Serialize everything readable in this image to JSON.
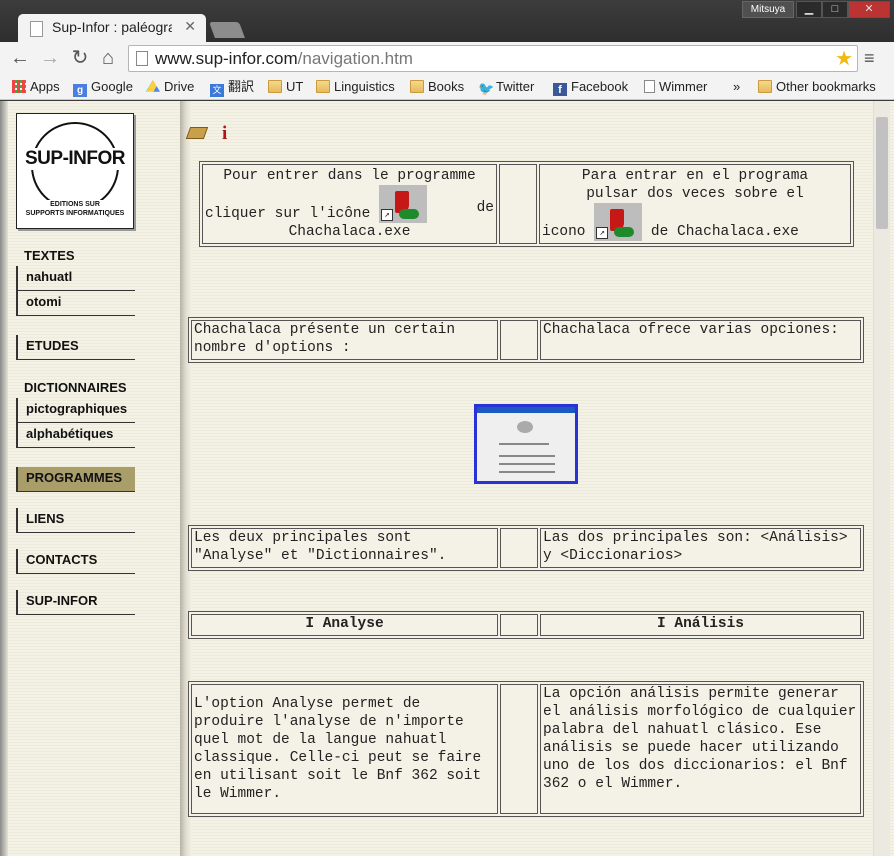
{
  "browser": {
    "tab_title": "Sup-Infor : paléographi",
    "user": "Mitsuya",
    "url_host": "www.sup-infor.com",
    "url_path": "/navigation.htm"
  },
  "bookmarks": [
    "Apps",
    "Google",
    "Drive",
    "翻訳",
    "UT",
    "Linguistics",
    "Books",
    "Twitter",
    "Facebook",
    "Wimmer",
    "»",
    "Other bookmarks"
  ],
  "logo": {
    "brand": "SUP-INFOR",
    "sub_line1": "EDITIONS SUR",
    "sub_line2": "SUPPORTS INFORMATIQUES"
  },
  "sidebar": {
    "textes": "TEXTES",
    "nahuatl": "nahuatl",
    "otomi": "otomi",
    "etudes": "ETUDES",
    "dictionnaires": "DICTIONNAIRES",
    "pictographiques": "pictographiques",
    "alphabetiques": "alphabétiques",
    "programmes": "PROGRAMMES",
    "liens": "LIENS",
    "contacts": "CONTACTS",
    "supinfor": "SUP-INFOR"
  },
  "content": {
    "fr_enter_1": "Pour entrer dans le programme",
    "fr_enter_2": "cliquer sur l'icône",
    "fr_enter_3": "de",
    "fr_enter_4": "Chachalaca.exe",
    "es_enter_1": "Para entrar en el programa",
    "es_enter_2": "pulsar dos veces sobre el",
    "es_enter_3": "icono",
    "es_enter_4": "de Chachalaca.exe",
    "fr_options": "Chachalaca présente un certain nombre d'options :",
    "es_options": "Chachalaca ofrece varias opciones:",
    "fr_main": "Les deux principales sont \"Analyse\" et \"Dictionnaires\".",
    "es_main": "Las dos principales son: <Análisis> y <Diccionarios>",
    "fr_heading": "I Analyse",
    "es_heading": "I  Análisis",
    "fr_analyse": "L'option Analyse permet de produire l'analyse  de n'importe quel mot de la langue nahuatl classique. Celle-ci peut se faire en utilisant soit le Bnf 362 soit le Wimmer.",
    "es_analisis": "La opción análisis permite generar el análisis morfológico de cualquier palabra del nahuatl clásico. Ese análisis se puede hacer utilizando uno de los dos diccionarios: el Bnf 362 o el Wimmer."
  }
}
